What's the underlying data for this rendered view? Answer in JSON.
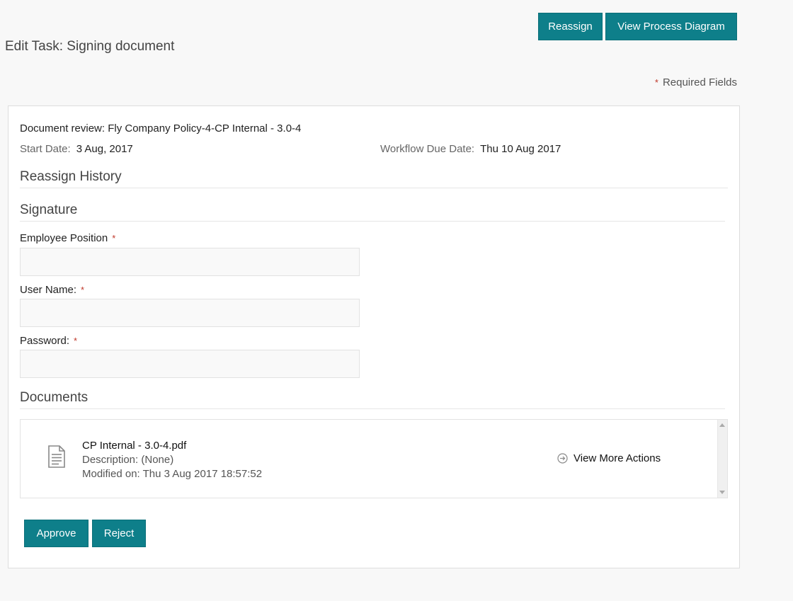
{
  "header": {
    "reassign_label": "Reassign",
    "view_process_label": "View Process Diagram",
    "title": "Edit Task: Signing document",
    "required_star": "*",
    "required_note": "Required Fields"
  },
  "task": {
    "document_review": "Document review: Fly Company Policy-4-CP Internal - 3.0-4",
    "start_date_label": "Start Date:",
    "start_date_value": "3 Aug, 2017",
    "due_date_label": "Workflow Due Date:",
    "due_date_value": "Thu 10 Aug 2017"
  },
  "sections": {
    "reassign_history": "Reassign History",
    "signature": "Signature",
    "documents": "Documents"
  },
  "form": {
    "employee_position": {
      "label": "Employee Position",
      "value": "",
      "required": "*"
    },
    "user_name": {
      "label": "User Name:",
      "value": "",
      "required": "*"
    },
    "password": {
      "label": "Password:",
      "value": "",
      "required": "*"
    }
  },
  "documents": [
    {
      "icon": "document-icon",
      "name": "CP Internal - 3.0-4.pdf",
      "description": "Description: (None)",
      "modified": "Modified on: Thu 3 Aug 2017 18:57:52",
      "more_actions": "View More Actions"
    }
  ],
  "actions": {
    "approve": "Approve",
    "reject": "Reject"
  },
  "colors": {
    "button": "#0e7f8a",
    "required_star": "#c0392b",
    "background": "#f8f8f8"
  }
}
